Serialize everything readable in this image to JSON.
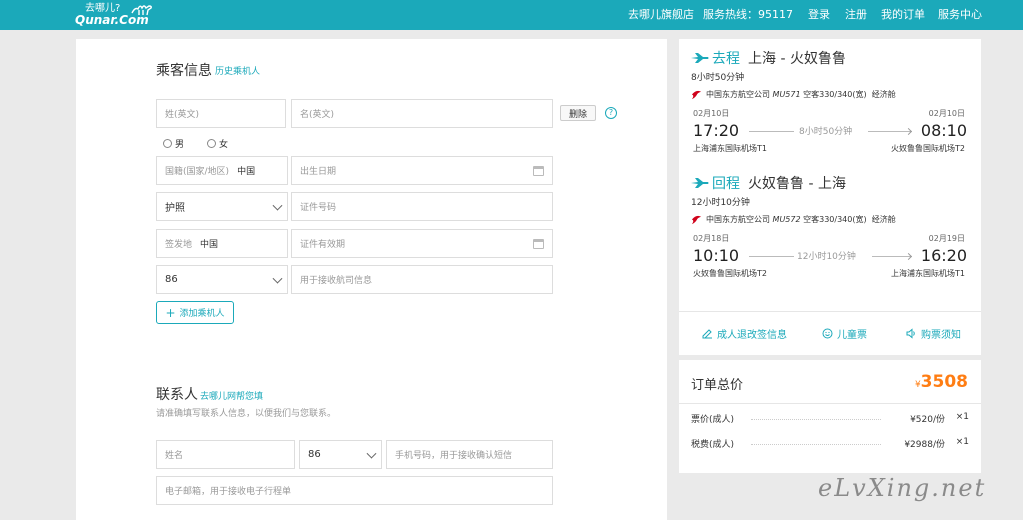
{
  "header": {
    "logo_cn": "去哪儿?",
    "logo_en": "Qunar.Com",
    "store": "去哪儿旗舰店",
    "hotline": "服务热线：95117",
    "login": "登录",
    "register": "注册",
    "my_orders": "我的订单",
    "service_center": "服务中心"
  },
  "passenger": {
    "title": "乘客信息",
    "history_link": "历史乘机人",
    "surname_placeholder": "姓(英文)",
    "given_placeholder": "名(英文)",
    "delete_label": "删除",
    "help": "?",
    "male": "男",
    "female": "女",
    "nationality_label": "国籍(国家/地区)",
    "nationality_value": "中国",
    "birth_placeholder": "出生日期",
    "id_type": "护照",
    "id_number_placeholder": "证件号码",
    "issue_place_label": "签发地",
    "issue_place_value": "中国",
    "expiry_placeholder": "证件有效期",
    "phone_code": "86",
    "phone_placeholder": "用于接收航司信息",
    "add_passenger": "添加乘机人"
  },
  "contact": {
    "title": "联系人",
    "help_link": "去哪儿网帮您填",
    "hint": "请准确填写联系人信息，以便我们与您联系。",
    "name_placeholder": "姓名",
    "phone_code": "86",
    "phone_placeholder": "手机号码，用于接收确认短信",
    "email_placeholder": "电子邮箱，用于接收电子行程单"
  },
  "outbound": {
    "tag": "去程",
    "route": "上海 - 火奴鲁鲁",
    "duration": "8小时50分钟",
    "airline": "中国东方航空公司",
    "flight_no": "MU571",
    "aircraft": "空客330/340(宽)",
    "cabin": "经济舱",
    "dep_date": "02月10日",
    "arr_date": "02月10日",
    "dep_time": "17:20",
    "arr_time": "08:10",
    "mid_duration": "8小时50分钟",
    "dep_airport": "上海浦东国际机场T1",
    "arr_airport": "火奴鲁鲁国际机场T2"
  },
  "return": {
    "tag": "回程",
    "route": "火奴鲁鲁 - 上海",
    "duration": "12小时10分钟",
    "airline": "中国东方航空公司",
    "flight_no": "MU572",
    "aircraft": "空客330/340(宽)",
    "cabin": "经济舱",
    "dep_date": "02月18日",
    "arr_date": "02月19日",
    "dep_time": "10:10",
    "arr_time": "16:20",
    "mid_duration": "12小时10分钟",
    "dep_airport": "火奴鲁鲁国际机场T2",
    "arr_airport": "上海浦东国际机场T1"
  },
  "flight_links": {
    "refund": "成人退改签信息",
    "child": "儿童票",
    "notice": "购票须知"
  },
  "price": {
    "title": "订单总价",
    "currency": "¥",
    "total": "3508",
    "rows": [
      {
        "label": "票价(成人)",
        "amount": "¥520/份",
        "qty": "×1"
      },
      {
        "label": "税费(成人)",
        "amount": "¥2988/份",
        "qty": "×1"
      }
    ]
  },
  "watermark": "eLvXing.net",
  "colors": {
    "accent": "#1ba9ba",
    "price": "#ff7d13",
    "airline": "#d0021b"
  }
}
